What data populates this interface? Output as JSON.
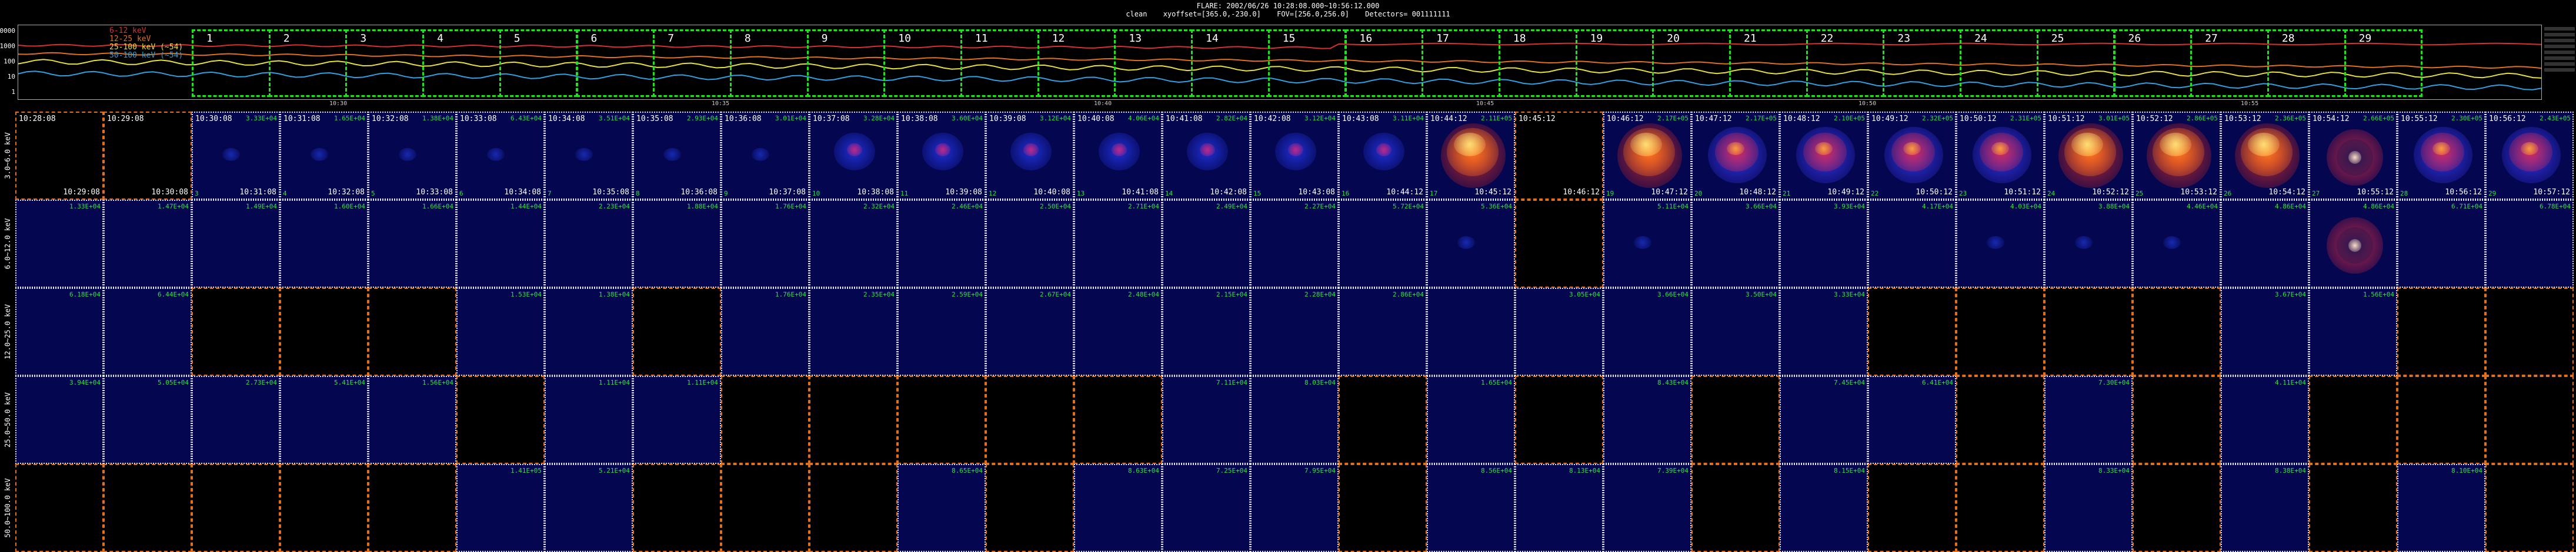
{
  "header": {
    "line1": "FLARE: 2002/06/26 10:28:08.000~10:56:12.000",
    "method": "clean",
    "xyoffset": "xyoffset=[365.0,-230.0]",
    "fov": "FOV=[256.0,256.0]",
    "detectors": "Detectors= 001111111"
  },
  "lightcurve": {
    "y_ticks": [
      "10000",
      "1000",
      "100",
      "10",
      "1"
    ],
    "legend": [
      {
        "label": "6-12 keV",
        "color": "#d83030"
      },
      {
        "label": "12-25 keV",
        "color": "#e07020"
      },
      {
        "label": "25-100 keV (~54)",
        "color": "#e8e040"
      },
      {
        "label": "50-100 keV (~54)",
        "color": "#30a0e0"
      }
    ],
    "x_ticks": [
      "10:30",
      "10:35",
      "10:40",
      "10:45",
      "10:50",
      "10:55"
    ],
    "intervals": [
      "1",
      "2",
      "3",
      "4",
      "5",
      "6",
      "7",
      "8",
      "9",
      "10",
      "11",
      "12",
      "13",
      "14",
      "15",
      "16",
      "17",
      "18",
      "19",
      "20",
      "21",
      "22",
      "23",
      "24",
      "25",
      "26",
      "27",
      "28",
      "29"
    ]
  },
  "bands": [
    "3.0~6.0 keV",
    "6.0~12.0 keV",
    "12.0~25.0 keV",
    "25.0~50.0 keV",
    "50.0~100.0 keV"
  ],
  "time_starts": [
    "10:28:08",
    "10:29:08",
    "10:30:08",
    "10:31:08",
    "10:32:08",
    "10:33:08",
    "10:34:08",
    "10:35:08",
    "10:36:08",
    "10:37:08",
    "10:38:08",
    "10:39:08",
    "10:40:08",
    "10:41:08",
    "10:42:08",
    "10:43:08",
    "10:44:12",
    "10:45:12",
    "10:46:12",
    "10:47:12",
    "10:48:12",
    "10:49:12",
    "10:50:12",
    "10:51:12",
    "10:52:12",
    "10:53:12",
    "10:54:12",
    "10:55:12",
    "10:56:12"
  ],
  "time_ends": [
    "10:29:08",
    "10:30:08",
    "10:31:08",
    "10:32:08",
    "10:33:08",
    "10:34:08",
    "10:35:08",
    "10:36:08",
    "10:37:08",
    "10:38:08",
    "10:39:08",
    "10:40:08",
    "10:41:08",
    "10:42:08",
    "10:43:08",
    "10:44:12",
    "10:45:12",
    "10:46:12",
    "10:47:12",
    "10:48:12",
    "10:49:12",
    "10:50:12",
    "10:51:12",
    "10:52:12",
    "10:53:12",
    "10:54:12",
    "10:55:12",
    "10:56:12",
    "10:57:12"
  ],
  "rows": [
    {
      "cells": [
        {
          "s": "b"
        },
        {
          "s": "b"
        },
        {
          "s": "i",
          "v": "3.33E+04",
          "n": "3",
          "k": "faint"
        },
        {
          "s": "i",
          "v": "1.65E+04",
          "n": "4",
          "k": "faint"
        },
        {
          "s": "i",
          "v": "1.38E+04",
          "n": "5",
          "k": "faint"
        },
        {
          "s": "i",
          "v": "6.43E+04",
          "n": "6",
          "k": "faint"
        },
        {
          "s": "i",
          "v": "3.51E+04",
          "n": "7",
          "k": "faint"
        },
        {
          "s": "i",
          "v": "2.93E+04",
          "n": "8",
          "k": "faint"
        },
        {
          "s": "i",
          "v": "3.01E+04",
          "n": "9",
          "k": "faint"
        },
        {
          "s": "i",
          "v": "3.28E+04",
          "n": "10",
          "k": "med"
        },
        {
          "s": "i",
          "v": "3.60E+04",
          "n": "11",
          "k": "med"
        },
        {
          "s": "i",
          "v": "3.12E+04",
          "n": "12",
          "k": "med"
        },
        {
          "s": "i",
          "v": "4.06E+04",
          "n": "13",
          "k": "med"
        },
        {
          "s": "i",
          "v": "2.82E+04",
          "n": "14",
          "k": "med"
        },
        {
          "s": "i",
          "v": "3.12E+04",
          "n": "15",
          "k": "med"
        },
        {
          "s": "i",
          "v": "3.11E+04",
          "n": "16",
          "k": "med"
        },
        {
          "s": "i",
          "v": "2.11E+05",
          "n": "17",
          "k": "hot"
        },
        {
          "s": "b"
        },
        {
          "s": "i",
          "v": "2.17E+05",
          "n": "19",
          "k": "hot"
        },
        {
          "s": "i",
          "v": "2.17E+05",
          "n": "20",
          "k": "warm"
        },
        {
          "s": "i",
          "v": "2.10E+05",
          "n": "21",
          "k": "warm"
        },
        {
          "s": "i",
          "v": "2.32E+05",
          "n": "22",
          "k": "warm"
        },
        {
          "s": "i",
          "v": "2.31E+05",
          "n": "23",
          "k": "warm"
        },
        {
          "s": "i",
          "v": "3.01E+05",
          "n": "24",
          "k": "hot"
        },
        {
          "s": "i",
          "v": "2.86E+05",
          "n": "25",
          "k": "hot"
        },
        {
          "s": "i",
          "v": "2.36E+05",
          "n": "26",
          "k": "hot"
        },
        {
          "s": "i",
          "v": "2.66E+05",
          "n": "27",
          "k": "ring"
        },
        {
          "s": "i",
          "v": "2.30E+05",
          "n": "28",
          "k": "warm"
        },
        {
          "s": "i",
          "v": "2.43E+05",
          "n": "29",
          "k": "warm"
        }
      ]
    },
    {
      "cells": [
        {
          "s": "i",
          "v": "1.33E+04",
          "n": "",
          "k": "none"
        },
        {
          "s": "i",
          "v": "1.47E+04",
          "n": "",
          "k": "none"
        },
        {
          "s": "i",
          "v": "1.49E+04",
          "n": "",
          "k": "none"
        },
        {
          "s": "i",
          "v": "1.60E+04",
          "n": "",
          "k": "none"
        },
        {
          "s": "i",
          "v": "1.66E+04",
          "n": "",
          "k": "none"
        },
        {
          "s": "i",
          "v": "1.44E+04",
          "n": "",
          "k": "none"
        },
        {
          "s": "i",
          "v": "2.23E+04",
          "n": "",
          "k": "none"
        },
        {
          "s": "i",
          "v": "1.88E+04",
          "n": "",
          "k": "none"
        },
        {
          "s": "i",
          "v": "1.76E+04",
          "n": "",
          "k": "none"
        },
        {
          "s": "i",
          "v": "2.32E+04",
          "n": "",
          "k": "none"
        },
        {
          "s": "i",
          "v": "2.46E+04",
          "n": "",
          "k": "none"
        },
        {
          "s": "i",
          "v": "2.50E+04",
          "n": "",
          "k": "none"
        },
        {
          "s": "i",
          "v": "2.71E+04",
          "n": "",
          "k": "none"
        },
        {
          "s": "i",
          "v": "2.49E+04",
          "n": "",
          "k": "none"
        },
        {
          "s": "i",
          "v": "2.27E+04",
          "n": "",
          "k": "none"
        },
        {
          "s": "i",
          "v": "5.72E+04",
          "n": "",
          "k": "none"
        },
        {
          "s": "i",
          "v": "5.36E+04",
          "n": "",
          "k": "faint"
        },
        {
          "s": "b"
        },
        {
          "s": "i",
          "v": "5.11E+04",
          "n": "",
          "k": "faint"
        },
        {
          "s": "i",
          "v": "3.66E+04",
          "n": "",
          "k": "none"
        },
        {
          "s": "i",
          "v": "3.93E+04",
          "n": "",
          "k": "none"
        },
        {
          "s": "i",
          "v": "4.17E+04",
          "n": "",
          "k": "none"
        },
        {
          "s": "i",
          "v": "4.03E+04",
          "n": "",
          "k": "faint"
        },
        {
          "s": "i",
          "v": "3.88E+04",
          "n": "",
          "k": "faint"
        },
        {
          "s": "i",
          "v": "4.46E+04",
          "n": "",
          "k": "faint"
        },
        {
          "s": "i",
          "v": "4.86E+04",
          "n": "",
          "k": "none"
        },
        {
          "s": "i",
          "v": "4.86E+04",
          "n": "",
          "k": "ring"
        },
        {
          "s": "i",
          "v": "6.71E+04",
          "n": "",
          "k": "none"
        },
        {
          "s": "i",
          "v": "6.78E+04",
          "n": "",
          "k": "none"
        }
      ]
    },
    {
      "cells": [
        {
          "s": "i",
          "v": "6.18E+04",
          "n": "",
          "k": "none"
        },
        {
          "s": "i",
          "v": "6.44E+04",
          "n": "",
          "k": "none"
        },
        {
          "s": "b"
        },
        {
          "s": "b"
        },
        {
          "s": "b"
        },
        {
          "s": "i",
          "v": "1.53E+04",
          "n": "",
          "k": "none"
        },
        {
          "s": "i",
          "v": "1.38E+04",
          "n": "",
          "k": "none"
        },
        {
          "s": "b"
        },
        {
          "s": "i",
          "v": "1.76E+04",
          "n": "",
          "k": "none"
        },
        {
          "s": "i",
          "v": "2.35E+04",
          "n": "",
          "k": "none"
        },
        {
          "s": "i",
          "v": "2.59E+04",
          "n": "",
          "k": "none"
        },
        {
          "s": "i",
          "v": "2.67E+04",
          "n": "",
          "k": "none"
        },
        {
          "s": "i",
          "v": "2.48E+04",
          "n": "",
          "k": "none"
        },
        {
          "s": "i",
          "v": "2.15E+04",
          "n": "",
          "k": "none"
        },
        {
          "s": "i",
          "v": "2.28E+04",
          "n": "",
          "k": "none"
        },
        {
          "s": "i",
          "v": "2.86E+04",
          "n": "",
          "k": "none"
        },
        {
          "s": "i",
          "v": "",
          "n": "",
          "k": "none"
        },
        {
          "s": "i",
          "v": "3.05E+04",
          "n": "",
          "k": "none"
        },
        {
          "s": "i",
          "v": "3.66E+04",
          "n": "",
          "k": "none"
        },
        {
          "s": "i",
          "v": "3.50E+04",
          "n": "",
          "k": "none"
        },
        {
          "s": "i",
          "v": "3.33E+04",
          "n": "",
          "k": "none"
        },
        {
          "s": "b"
        },
        {
          "s": "b"
        },
        {
          "s": "b"
        },
        {
          "s": "b"
        },
        {
          "s": "i",
          "v": "3.67E+04",
          "n": "",
          "k": "none"
        },
        {
          "s": "i",
          "v": "1.56E+04",
          "n": "",
          "k": "none"
        },
        {
          "s": "b"
        },
        {
          "s": "b"
        }
      ]
    },
    {
      "cells": [
        {
          "s": "i",
          "v": "3.94E+04",
          "n": "",
          "k": "none"
        },
        {
          "s": "i",
          "v": "5.05E+04",
          "n": "",
          "k": "none"
        },
        {
          "s": "i",
          "v": "2.73E+04",
          "n": "",
          "k": "none"
        },
        {
          "s": "i",
          "v": "5.41E+04",
          "n": "",
          "k": "none"
        },
        {
          "s": "i",
          "v": "1.56E+04",
          "n": "",
          "k": "none"
        },
        {
          "s": "b"
        },
        {
          "s": "i",
          "v": "1.11E+04",
          "n": "",
          "k": "none"
        },
        {
          "s": "i",
          "v": "1.11E+04",
          "n": "",
          "k": "none"
        },
        {
          "s": "b"
        },
        {
          "s": "b"
        },
        {
          "s": "b"
        },
        {
          "s": "b"
        },
        {
          "s": "b"
        },
        {
          "s": "i",
          "v": "7.11E+04",
          "n": "",
          "k": "none"
        },
        {
          "s": "i",
          "v": "8.03E+04",
          "n": "",
          "k": "none"
        },
        {
          "s": "b"
        },
        {
          "s": "i",
          "v": "1.65E+04",
          "n": "",
          "k": "none"
        },
        {
          "s": "b"
        },
        {
          "s": "i",
          "v": "8.43E+04",
          "n": "",
          "k": "none"
        },
        {
          "s": "b"
        },
        {
          "s": "i",
          "v": "7.45E+04",
          "n": "",
          "k": "none"
        },
        {
          "s": "i",
          "v": "6.41E+04",
          "n": "",
          "k": "none"
        },
        {
          "s": "b"
        },
        {
          "s": "i",
          "v": "7.30E+04",
          "n": "",
          "k": "none"
        },
        {
          "s": "b"
        },
        {
          "s": "i",
          "v": "4.11E+04",
          "n": "",
          "k": "none"
        },
        {
          "s": "b"
        },
        {
          "s": "b"
        },
        {
          "s": "b"
        }
      ]
    },
    {
      "cells": [
        {
          "s": "b"
        },
        {
          "s": "b"
        },
        {
          "s": "b"
        },
        {
          "s": "b"
        },
        {
          "s": "b"
        },
        {
          "s": "i",
          "v": "1.41E+05",
          "n": "",
          "k": "none"
        },
        {
          "s": "i",
          "v": "5.21E+04",
          "n": "",
          "k": "none"
        },
        {
          "s": "b"
        },
        {
          "s": "b"
        },
        {
          "s": "b"
        },
        {
          "s": "i",
          "v": "8.65E+04",
          "n": "",
          "k": "none"
        },
        {
          "s": "b"
        },
        {
          "s": "i",
          "v": "8.63E+04",
          "n": "",
          "k": "none"
        },
        {
          "s": "i",
          "v": "7.25E+04",
          "n": "",
          "k": "none"
        },
        {
          "s": "i",
          "v": "7.95E+04",
          "n": "",
          "k": "none"
        },
        {
          "s": "b"
        },
        {
          "s": "i",
          "v": "8.56E+04",
          "n": "",
          "k": "none"
        },
        {
          "s": "i",
          "v": "8.13E+04",
          "n": "",
          "k": "none"
        },
        {
          "s": "i",
          "v": "7.39E+04",
          "n": "",
          "k": "none"
        },
        {
          "s": "b"
        },
        {
          "s": "i",
          "v": "8.15E+04",
          "n": "",
          "k": "none"
        },
        {
          "s": "b"
        },
        {
          "s": "b"
        },
        {
          "s": "i",
          "v": "8.33E+04",
          "n": "",
          "k": "none"
        },
        {
          "s": "b"
        },
        {
          "s": "i",
          "v": "8.38E+04",
          "n": "",
          "k": "none"
        },
        {
          "s": "b"
        },
        {
          "s": "i",
          "v": "8.10E+04",
          "n": "",
          "k": "none"
        },
        {
          "s": "b"
        }
      ]
    }
  ],
  "colors": {
    "image_bg": "#04064f",
    "interval_box": "#22e122",
    "blank_border": "#e07020",
    "value_text": "#2fe04a"
  }
}
